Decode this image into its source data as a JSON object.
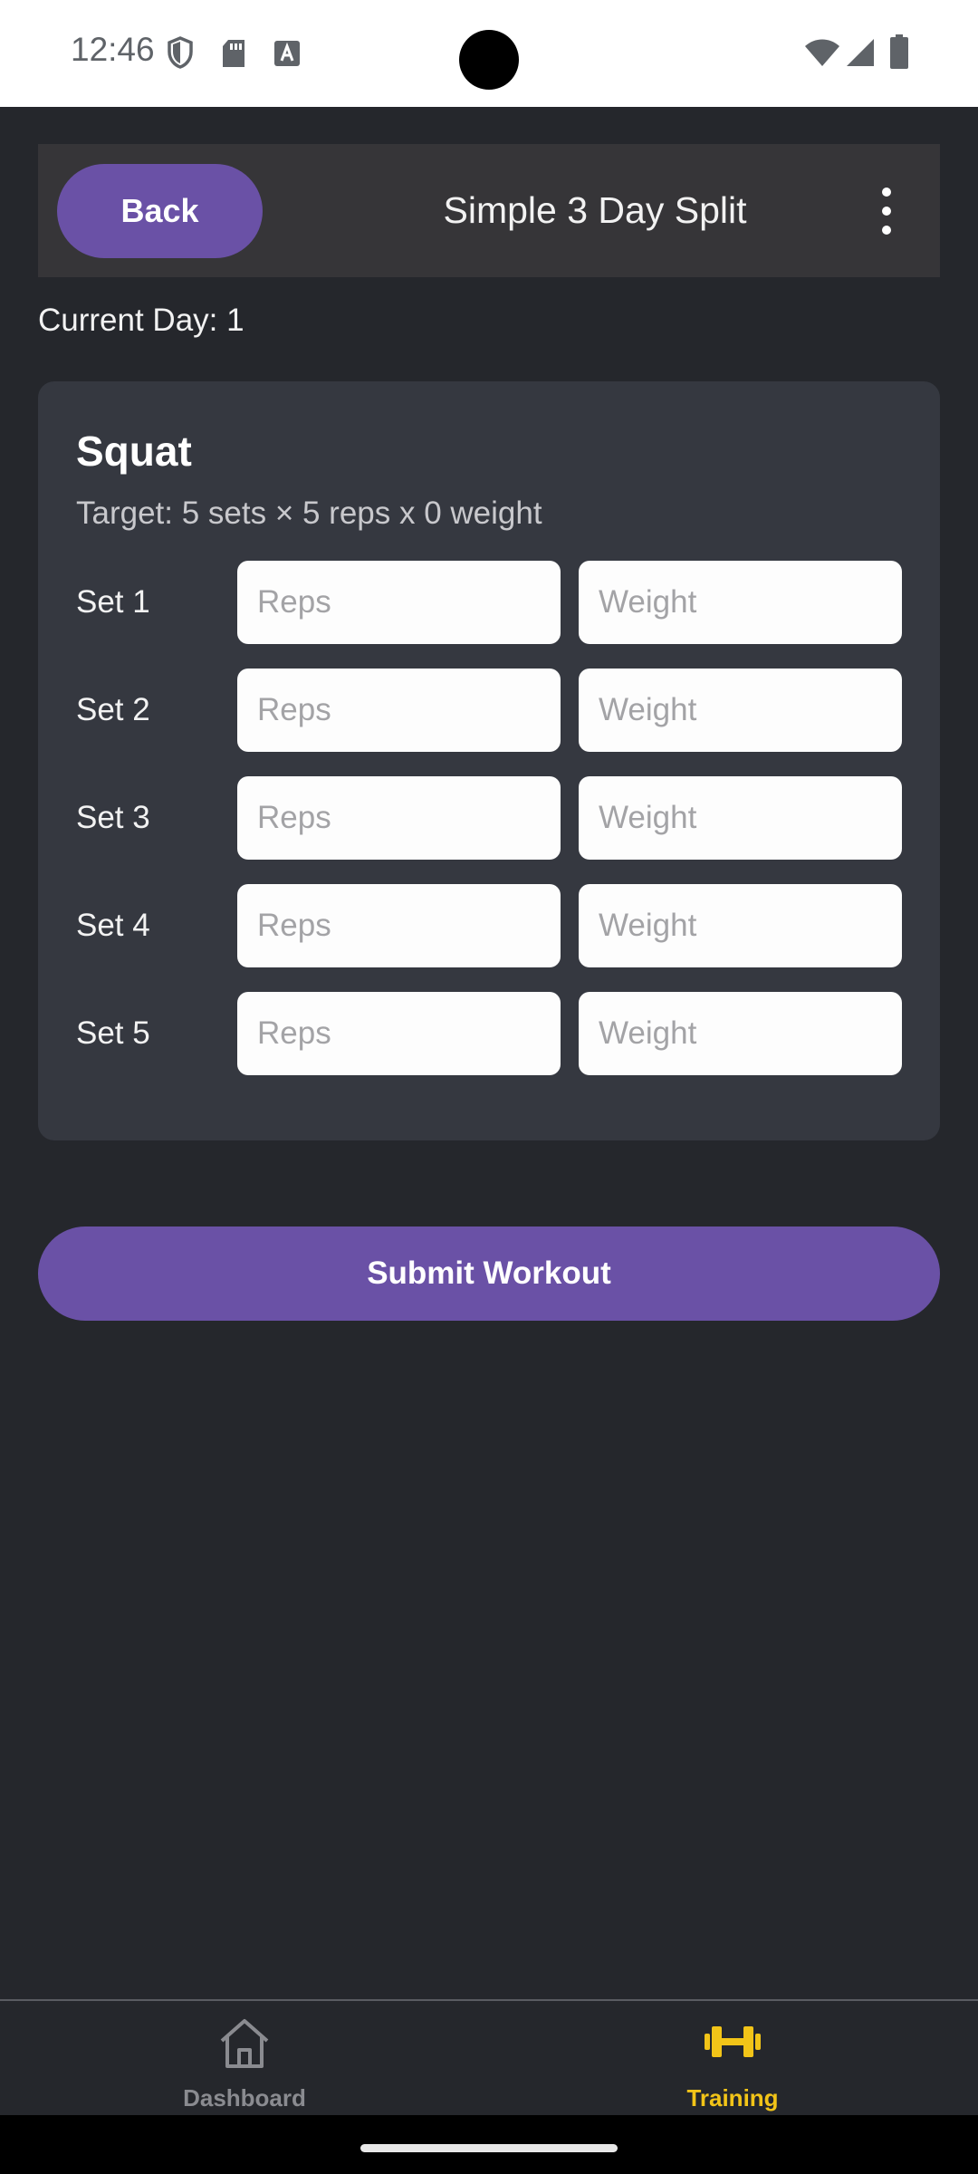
{
  "status_bar": {
    "time": "12:46",
    "icons_left": [
      "shield-icon",
      "sd-card-icon",
      "font-a-icon"
    ],
    "icons_right": [
      "wifi-icon",
      "signal-icon",
      "battery-icon"
    ]
  },
  "header": {
    "back_label": "Back",
    "title": "Simple 3 Day Split",
    "menu_icon": "more-vert-icon"
  },
  "current_day": "Current Day: 1",
  "exercise": {
    "name": "Squat",
    "target": "Target: 5 sets × 5 reps x 0 weight",
    "sets": [
      {
        "label": "Set 1",
        "reps_placeholder": "Reps",
        "weight_placeholder": "Weight",
        "reps_value": "",
        "weight_value": ""
      },
      {
        "label": "Set 2",
        "reps_placeholder": "Reps",
        "weight_placeholder": "Weight",
        "reps_value": "",
        "weight_value": ""
      },
      {
        "label": "Set 3",
        "reps_placeholder": "Reps",
        "weight_placeholder": "Weight",
        "reps_value": "",
        "weight_value": ""
      },
      {
        "label": "Set 4",
        "reps_placeholder": "Reps",
        "weight_placeholder": "Weight",
        "reps_value": "",
        "weight_value": ""
      },
      {
        "label": "Set 5",
        "reps_placeholder": "Reps",
        "weight_placeholder": "Weight",
        "reps_value": "",
        "weight_value": ""
      }
    ]
  },
  "submit_label": "Submit Workout",
  "bottom_nav": {
    "items": [
      {
        "label": "Dashboard",
        "icon": "home-icon",
        "active": false
      },
      {
        "label": "Training",
        "icon": "dumbbell-icon",
        "active": true
      }
    ]
  },
  "colors": {
    "background": "#25272c",
    "accent": "#6a51a6",
    "card": "#353840",
    "active_nav": "#f2c418",
    "inactive_nav": "#8a8b90"
  }
}
